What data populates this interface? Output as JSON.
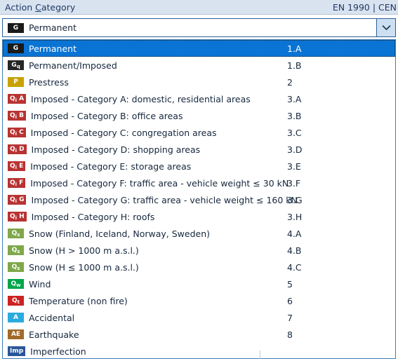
{
  "header": {
    "title_prefix": "Action ",
    "title_accel": "C",
    "title_suffix": "ategory",
    "standard": "EN 1990 | CEN"
  },
  "combobox": {
    "selected_badge": "G",
    "selected_label": "Permanent",
    "arrow_icon": "chevron-down-icon",
    "badge_color": "#1a1a1a"
  },
  "dropdown": {
    "options": [
      {
        "badge": "G",
        "badge_sub": "",
        "badge_suffix": "",
        "label": "Permanent",
        "code": "1.A",
        "color": "#1a1a1a",
        "text_color": "#ffffff",
        "selected": true
      },
      {
        "badge": "G",
        "badge_sub": "q",
        "badge_suffix": "",
        "label": "Permanent/Imposed",
        "code": "1.B",
        "color": "#262626",
        "text_color": "#ffffff",
        "selected": false
      },
      {
        "badge": "P",
        "badge_sub": "",
        "badge_suffix": "",
        "label": "Prestress",
        "code": "2",
        "color": "#c8a200",
        "text_color": "#ffffff",
        "selected": false
      },
      {
        "badge": "Q",
        "badge_sub": "i",
        "badge_suffix": "A",
        "label": "Imposed - Category A: domestic, residential areas",
        "code": "3.A",
        "color": "#b83232",
        "text_color": "#ffffff",
        "selected": false
      },
      {
        "badge": "Q",
        "badge_sub": "i",
        "badge_suffix": "B",
        "label": "Imposed - Category B: office areas",
        "code": "3.B",
        "color": "#b83232",
        "text_color": "#ffffff",
        "selected": false
      },
      {
        "badge": "Q",
        "badge_sub": "i",
        "badge_suffix": "C",
        "label": "Imposed - Category C: congregation areas",
        "code": "3.C",
        "color": "#b83232",
        "text_color": "#ffffff",
        "selected": false
      },
      {
        "badge": "Q",
        "badge_sub": "i",
        "badge_suffix": "D",
        "label": "Imposed - Category D: shopping areas",
        "code": "3.D",
        "color": "#b83232",
        "text_color": "#ffffff",
        "selected": false
      },
      {
        "badge": "Q",
        "badge_sub": "i",
        "badge_suffix": "E",
        "label": "Imposed - Category E: storage areas",
        "code": "3.E",
        "color": "#b83232",
        "text_color": "#ffffff",
        "selected": false
      },
      {
        "badge": "Q",
        "badge_sub": "i",
        "badge_suffix": "F",
        "label": "Imposed - Category F: traffic area - vehicle weight ≤ 30 kN",
        "code": "3.F",
        "color": "#b83232",
        "text_color": "#ffffff",
        "selected": false
      },
      {
        "badge": "Q",
        "badge_sub": "i",
        "badge_suffix": "G",
        "label": "Imposed - Category G: traffic area - vehicle weight ≤ 160 kN",
        "code": "3.G",
        "color": "#b83232",
        "text_color": "#ffffff",
        "selected": false
      },
      {
        "badge": "Q",
        "badge_sub": "i",
        "badge_suffix": "H",
        "label": "Imposed - Category H: roofs",
        "code": "3.H",
        "color": "#b83232",
        "text_color": "#ffffff",
        "selected": false
      },
      {
        "badge": "Q",
        "badge_sub": "s",
        "badge_suffix": "",
        "label": "Snow (Finland, Iceland, Norway, Sweden)",
        "code": "4.A",
        "color": "#7fa84a",
        "text_color": "#ffffff",
        "selected": false
      },
      {
        "badge": "Q",
        "badge_sub": "s",
        "badge_suffix": "",
        "label": "Snow (H > 1000 m a.s.l.)",
        "code": "4.B",
        "color": "#7fa84a",
        "text_color": "#ffffff",
        "selected": false
      },
      {
        "badge": "Q",
        "badge_sub": "s",
        "badge_suffix": "",
        "label": "Snow (H ≤ 1000 m a.s.l.)",
        "code": "4.C",
        "color": "#7fa84a",
        "text_color": "#ffffff",
        "selected": false
      },
      {
        "badge": "Q",
        "badge_sub": "w",
        "badge_suffix": "",
        "label": "Wind",
        "code": "5",
        "color": "#00a64a",
        "text_color": "#ffffff",
        "selected": false
      },
      {
        "badge": "Q",
        "badge_sub": "t",
        "badge_suffix": "",
        "label": "Temperature (non fire)",
        "code": "6",
        "color": "#cc2222",
        "text_color": "#ffffff",
        "selected": false
      },
      {
        "badge": "A",
        "badge_sub": "",
        "badge_suffix": "",
        "label": "Accidental",
        "code": "7",
        "color": "#2aabdd",
        "text_color": "#ffffff",
        "selected": false
      },
      {
        "badge": "AE",
        "badge_sub": "",
        "badge_suffix": "",
        "label": "Earthquake",
        "code": "8",
        "color": "#a06a28",
        "text_color": "#ffffff",
        "selected": false
      },
      {
        "badge": "Imp",
        "badge_sub": "",
        "badge_suffix": "",
        "label": "Imperfection",
        "code": "",
        "color": "#2a5699",
        "text_color": "#ffffff",
        "selected": false
      }
    ]
  },
  "colors": {
    "header_bg": "#d9e3f0",
    "selection_blue": "#0a74d4",
    "border_blue": "#3f7cb5",
    "text": "#16273d"
  }
}
